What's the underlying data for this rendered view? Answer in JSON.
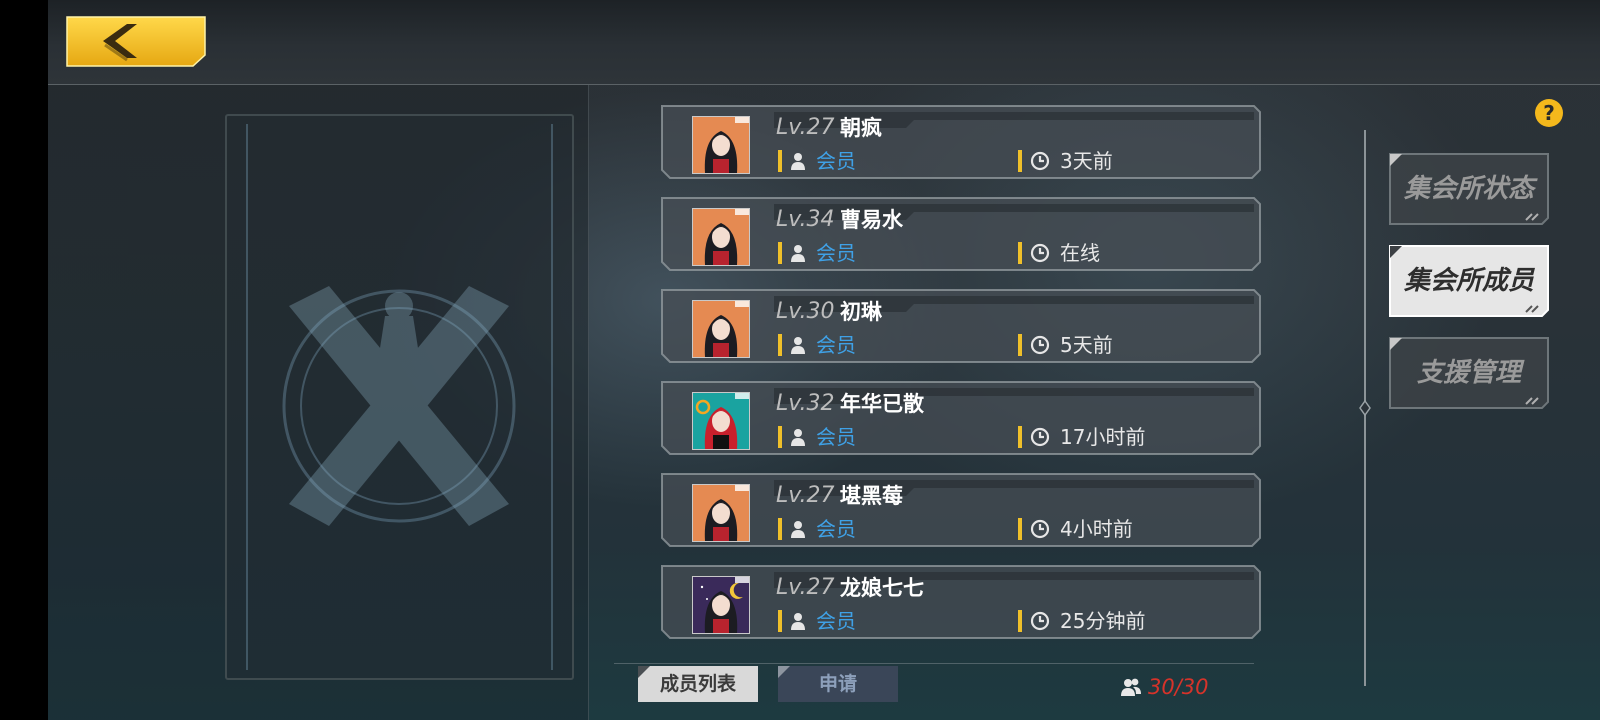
{
  "header": {
    "back_icon": "chevron-left-icon",
    "colors": {
      "back_button": "#f0c232",
      "back_chevron": "#3a2c10"
    }
  },
  "help": {
    "icon": "question-icon",
    "color": "#f4b81c"
  },
  "members": [
    {
      "level": "Lv.27",
      "name": "朝疯",
      "role": "会员",
      "last_seen": "3天前",
      "avatar": "avatar-orange"
    },
    {
      "level": "Lv.34",
      "name": "曹易水",
      "role": "会员",
      "last_seen": "在线",
      "avatar": "avatar-orange"
    },
    {
      "level": "Lv.30",
      "name": "初琳",
      "role": "会员",
      "last_seen": "5天前",
      "avatar": "avatar-orange"
    },
    {
      "level": "Lv.32",
      "name": "年华已散",
      "role": "会员",
      "last_seen": "17小时前",
      "avatar": "avatar-teal"
    },
    {
      "level": "Lv.27",
      "name": "堪黑莓",
      "role": "会员",
      "last_seen": "4小时前",
      "avatar": "avatar-orange"
    },
    {
      "level": "Lv.27",
      "name": "龙娘七七",
      "role": "会员",
      "last_seen": "25分钟前",
      "avatar": "avatar-night"
    }
  ],
  "side_menu": [
    {
      "label": "集会所状态",
      "selected": false
    },
    {
      "label": "集会所成员",
      "selected": true
    },
    {
      "label": "支援管理",
      "selected": false
    }
  ],
  "tabs": [
    {
      "label": "成员列表",
      "selected": true
    },
    {
      "label": "申请",
      "selected": false
    }
  ],
  "member_count": "30/30",
  "colors": {
    "role_text": "#3fa1e6",
    "accent_bar": "#f0c02a",
    "count_text": "#d6332a"
  }
}
